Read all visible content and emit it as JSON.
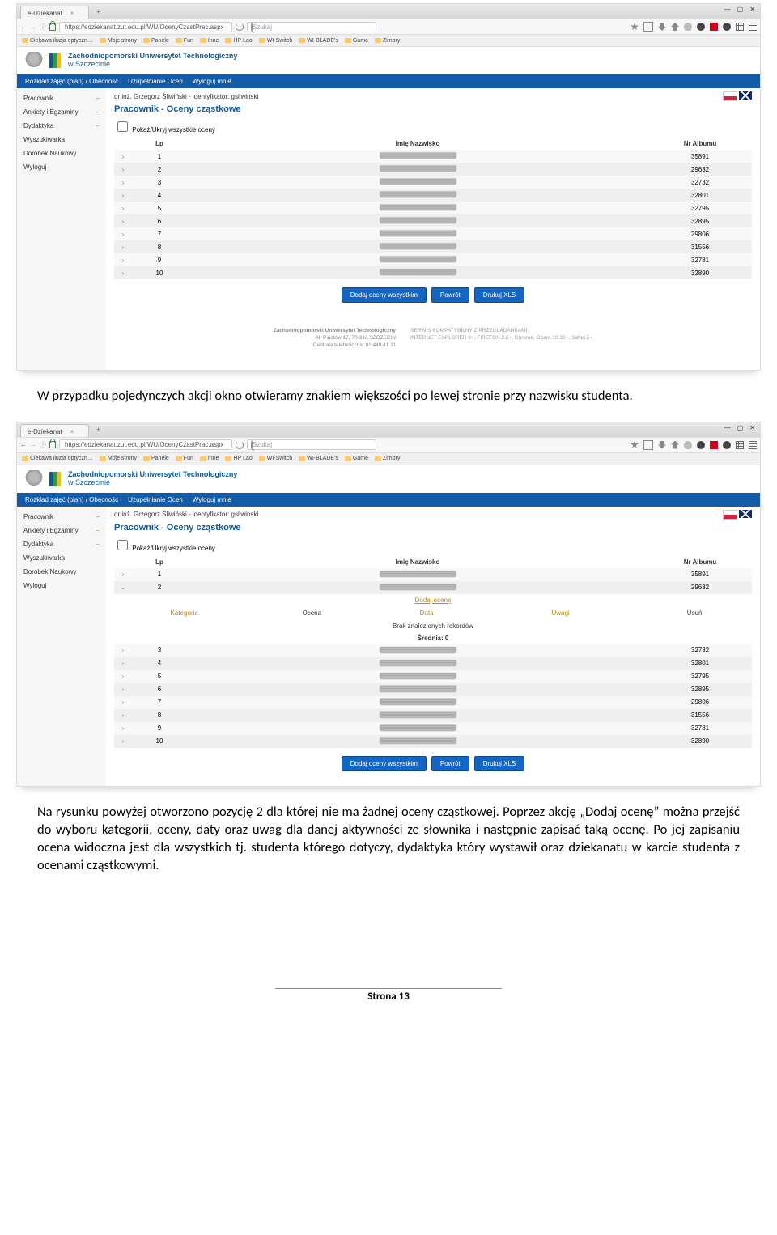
{
  "browser": {
    "tab_title": "e-Dziekanat",
    "url": "https://edziekanat.zut.edu.pl/WU/OcenyCzastPrac.aspx",
    "search_placeholder": "Szukaj",
    "win_min": "—",
    "win_max": "▢",
    "win_close": "✕",
    "bookmarks": [
      "Ciekawa iluzja optyczn…",
      "Moje strony",
      "Panele",
      "Fun",
      "Inne",
      "HP Lao",
      "WI-Switch",
      "WI-BLADE's",
      "Game",
      "Zimbry"
    ]
  },
  "university": {
    "line1": "Zachodniopomorski Uniwersytet Technologiczny",
    "line2": "w Szczecinie"
  },
  "nav": {
    "rozklad": "Rozkład zajęć (plan) / Obecność",
    "uzup": "Uzupełnianie Ocen",
    "wyloguj": "Wyloguj mnie"
  },
  "sidebar": {
    "items": [
      {
        "label": "Pracownik",
        "caret": "–"
      },
      {
        "label": "Ankiety i Egzaminy",
        "caret": "–"
      },
      {
        "label": "Dydaktyka",
        "caret": "–"
      },
      {
        "label": "Wyszukiwarka",
        "caret": ""
      },
      {
        "label": "Dorobek Naukowy",
        "caret": ""
      },
      {
        "label": "Wyloguj",
        "caret": ""
      }
    ]
  },
  "main": {
    "breadcrumb": "dr inż. Grzegorz Śliwiński - identyfikator: gsliwinski",
    "title": "Pracownik - Oceny cząstkowe",
    "checkbox": "Pokaż/Ukryj wszystkie oceny",
    "th_lp": "Lp",
    "th_name": "Imię Nazwisko",
    "th_alb": "Nr Albumu",
    "rows": [
      {
        "lp": "1",
        "alb": "35891"
      },
      {
        "lp": "2",
        "alb": "29632"
      },
      {
        "lp": "3",
        "alb": "32732"
      },
      {
        "lp": "4",
        "alb": "32801"
      },
      {
        "lp": "5",
        "alb": "32795"
      },
      {
        "lp": "6",
        "alb": "32895"
      },
      {
        "lp": "7",
        "alb": "29806"
      },
      {
        "lp": "8",
        "alb": "31556"
      },
      {
        "lp": "9",
        "alb": "32781"
      },
      {
        "lp": "10",
        "alb": "32890"
      }
    ],
    "rows_b_top": [
      {
        "lp": "1",
        "alb": "35891",
        "exp": "›"
      },
      {
        "lp": "2",
        "alb": "29632",
        "exp": "⌄"
      }
    ],
    "rows_b_bottom": [
      {
        "lp": "3",
        "alb": "32732"
      },
      {
        "lp": "4",
        "alb": "32801"
      },
      {
        "lp": "5",
        "alb": "32795"
      },
      {
        "lp": "6",
        "alb": "32895"
      },
      {
        "lp": "7",
        "alb": "29806"
      },
      {
        "lp": "8",
        "alb": "31556"
      },
      {
        "lp": "9",
        "alb": "32781"
      },
      {
        "lp": "10",
        "alb": "32890"
      }
    ],
    "expanded": {
      "add": "Dodaj ocenę",
      "cat": "Kategoria",
      "grade": "Ocena",
      "date": "Data",
      "notes": "Uwagi",
      "del": "Usuń",
      "empty": "Brak znalezionych rekordów",
      "avg": "Średnia: 0"
    },
    "btn_all": "Dodaj oceny wszystkim",
    "btn_back": "Powrót",
    "btn_xls": "Drukuj XLS"
  },
  "footer": {
    "uni": "Zachodniopomorski Uniwersytet Technologiczny",
    "addr": "Al. Piastów 17, 70-310 SZCZECIN",
    "tel": "Centrala telefoniczna: 91 449 41 11",
    "compat1": "SERWIS KOMPATYBILNY Z PRZEGLĄDARKAMI:",
    "compat2": "INTERNET EXPLORER 8+, FIREFOX 3.6+, Chrome, Opera 10.30+, Safari 5+"
  },
  "text": {
    "p1": "W przypadku pojedynczych akcji okno otwieramy znakiem większości po lewej stronie przy nazwisku studenta.",
    "p2": "Na rysunku powyżej otworzono pozycję 2 dla której nie ma żadnej oceny cząstkowej. Poprzez akcję „Dodaj ocenę” można przejść do wyboru kategorii, oceny, daty oraz uwag dla danej aktywności ze słownika i następnie zapisać taką ocenę. Po jej zapisaniu ocena widoczna jest dla wszystkich tj. studenta którego dotyczy, dydaktyka który wystawił oraz dziekanatu w karcie studenta z ocenami cząstkowymi.",
    "page_label": "Strona ",
    "page_num": "13"
  }
}
